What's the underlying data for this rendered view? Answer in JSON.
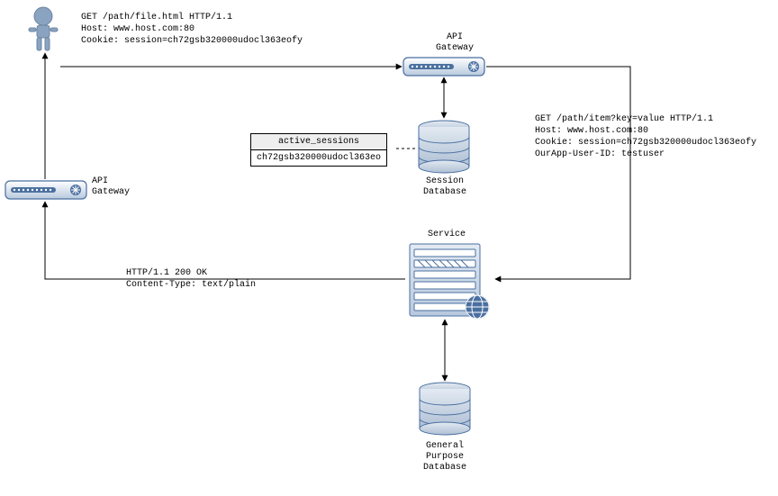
{
  "nodes": {
    "user": {
      "name": "user-icon"
    },
    "gateway_top": {
      "label": "API\nGateway"
    },
    "gateway_left": {
      "label": "API\nGateway"
    },
    "session_db": {
      "label": "Session\nDatabase"
    },
    "service": {
      "label": "Service"
    },
    "general_db": {
      "label": "General\nPurpose\nDatabase"
    }
  },
  "table": {
    "header": "active_sessions",
    "row": "ch72gsb320000udocl363eo"
  },
  "messages": {
    "req1": "GET /path/file.html HTTP/1.1\nHost: www.host.com:80\nCookie: session=ch72gsb320000udocl363eofy",
    "req2": "GET /path/item?key=value HTTP/1.1\nHost: www.host.com:80\nCookie: session=ch72gsb320000udocl363eofy\nOurApp-User-ID: testuser",
    "resp": "HTTP/1.1 200 OK\nContent-Type: text/plain"
  }
}
